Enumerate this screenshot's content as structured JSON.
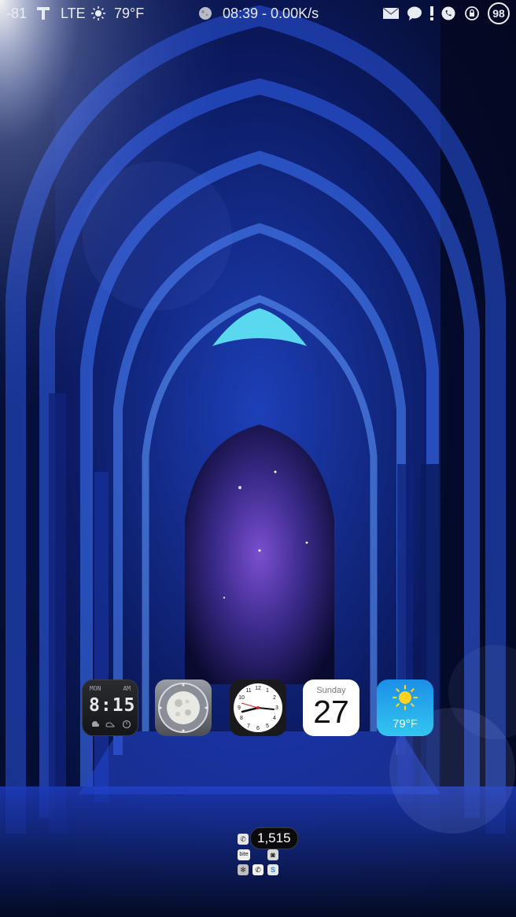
{
  "status_bar": {
    "signal_strength": "-81",
    "carrier_icon": "t-mobile-icon",
    "network_type": "LTE",
    "weather_icon": "sun-icon",
    "temperature": "79°F",
    "moon_icon": "moon-phase-icon",
    "time_speed": "08:39 - 0.00K/s",
    "notification_icons": [
      "mail-icon",
      "chat-bubble-icon",
      "alert-icon",
      "whatsapp-icon",
      "rotation-lock-icon"
    ],
    "battery_level": "98"
  },
  "home_icons": [
    {
      "name": "digital-clock-widget",
      "time": "8:15",
      "ampm": "AM",
      "label_left": "MON"
    },
    {
      "name": "moon-phase-app",
      "icon": "moon-icon"
    },
    {
      "name": "clock-app",
      "icon": "analog-clock-icon"
    },
    {
      "name": "calendar-app",
      "day": "Sunday",
      "date": "27"
    },
    {
      "name": "weather-app",
      "icon": "sun-icon",
      "temp": "79°F"
    }
  ],
  "dock_folder": {
    "badge_count": "1,515",
    "mini_label": "bite",
    "apps": [
      "phone-icon",
      "bite-app",
      "camera-icon",
      "settings-icon",
      "phone-icon",
      "skype-icon"
    ]
  },
  "colors": {
    "wallpaper_deep": "#040a24",
    "wallpaper_blue": "#1f46c4",
    "wallpaper_cyan": "#5ad8f0",
    "nebula": "#5a3aa8",
    "weather_blue": "#1b8fe8"
  }
}
